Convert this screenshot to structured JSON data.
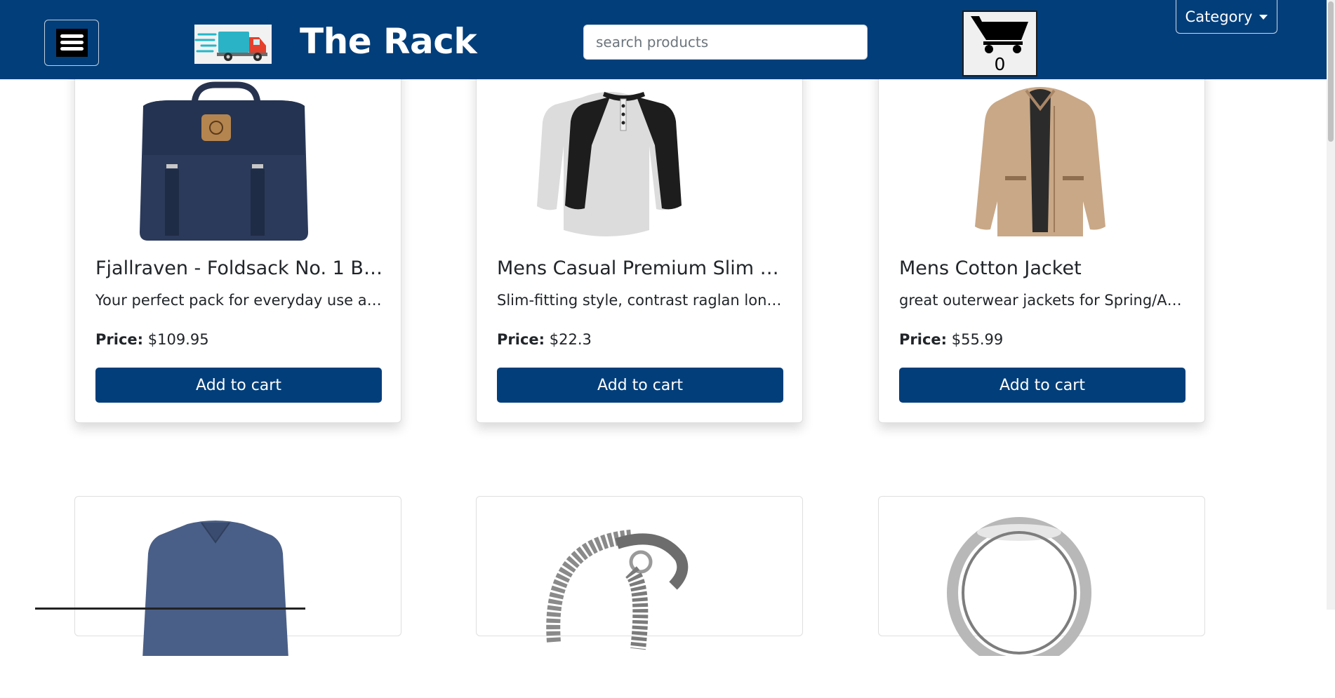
{
  "header": {
    "title": "The Rack",
    "search_placeholder": "search products",
    "cart_count": "0",
    "category_label": "Category",
    "menu_icon": "hamburger-menu-icon",
    "logo_icon": "delivery-truck-logo",
    "cart_icon": "shopping-cart-icon",
    "colors": {
      "header_bg": "#023e7a",
      "button_bg": "#023e7a"
    }
  },
  "products": [
    {
      "title": "Fjallraven - Foldsack No. 1 Bac...",
      "description": "Your perfect pack for everyday use and...",
      "price_label": "Price:",
      "price": "$109.95",
      "button": "Add to cart",
      "image": "navy-backpack"
    },
    {
      "title": "Mens Casual Premium Slim Fi...",
      "description": "Slim-fitting style, contrast raglan long s...",
      "price_label": "Price:",
      "price": "$22.3",
      "button": "Add to cart",
      "image": "raglan-henley-shirt"
    },
    {
      "title": "Mens Cotton Jacket",
      "description": "great outerwear jackets for Spring/Aut...",
      "price_label": "Price:",
      "price": "$55.99",
      "button": "Add to cart",
      "image": "khaki-cotton-jacket"
    },
    {
      "image": "blue-v-neck-shirt"
    },
    {
      "image": "dragon-chain-bracelet"
    },
    {
      "image": "silver-ring"
    }
  ]
}
